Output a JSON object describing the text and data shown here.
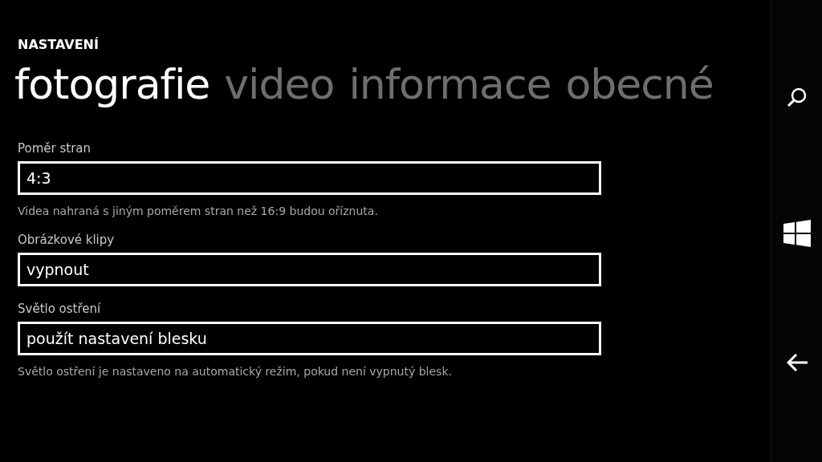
{
  "page": {
    "title": "NASTAVENÍ"
  },
  "pivots": [
    {
      "label": "fotografie",
      "selected": true
    },
    {
      "label": "video",
      "selected": false
    },
    {
      "label": "informace",
      "selected": false
    },
    {
      "label": "obecné",
      "selected": false
    }
  ],
  "settings": [
    {
      "label": "Poměr stran",
      "value": "4:3",
      "note": "Videa nahraná s jiným poměrem stran než 16:9 budou oříznuta."
    },
    {
      "label": "Obrázkové klipy",
      "value": "vypnout"
    },
    {
      "label": "Světlo ostření",
      "value": "použít nastavení blesku",
      "note": "Světlo ostření je nastaveno na automatický režim, pokud není vypnutý blesk."
    }
  ]
}
